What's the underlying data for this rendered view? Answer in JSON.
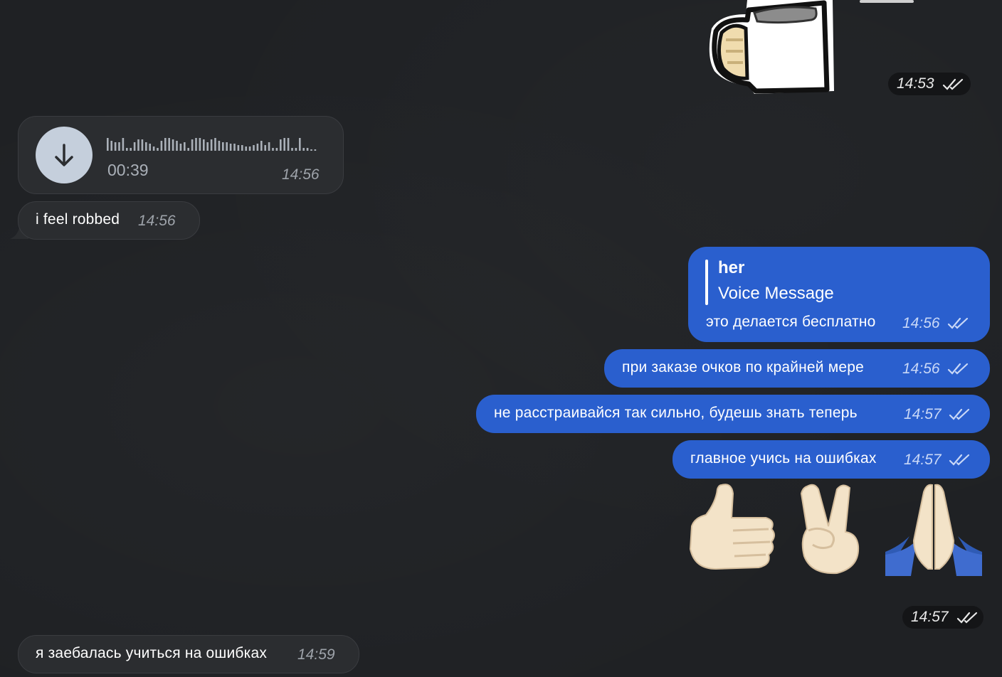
{
  "chat": {
    "sticker": {
      "name": "mug-sticker",
      "time": "14:53"
    },
    "voice": {
      "duration": "00:39",
      "time": "14:56"
    },
    "messages": {
      "m1": {
        "text": "i feel robbed",
        "time": "14:56"
      },
      "m2": {
        "reply_author": "her",
        "reply_text": "Voice Message",
        "text": "это делается бесплатно",
        "time": "14:56"
      },
      "m3": {
        "text": "при заказе очков по крайней мере",
        "time": "14:56"
      },
      "m4": {
        "text": "не расстраивайся так сильно, будешь знать теперь",
        "time": "14:57"
      },
      "m5": {
        "text": "главное учись на ошибках",
        "time": "14:57"
      },
      "m6": {
        "emoji": [
          "thumbs-up",
          "victory-hand",
          "folded-hands"
        ],
        "time": "14:57"
      },
      "m7": {
        "text": "я заебалась учиться на ошибках",
        "time": "14:59"
      }
    }
  },
  "colors": {
    "background": "#1f2124",
    "incoming_bubble": "#2b2d30",
    "outgoing_bubble": "#2a5fce",
    "voice_button": "#c5cfdc"
  }
}
